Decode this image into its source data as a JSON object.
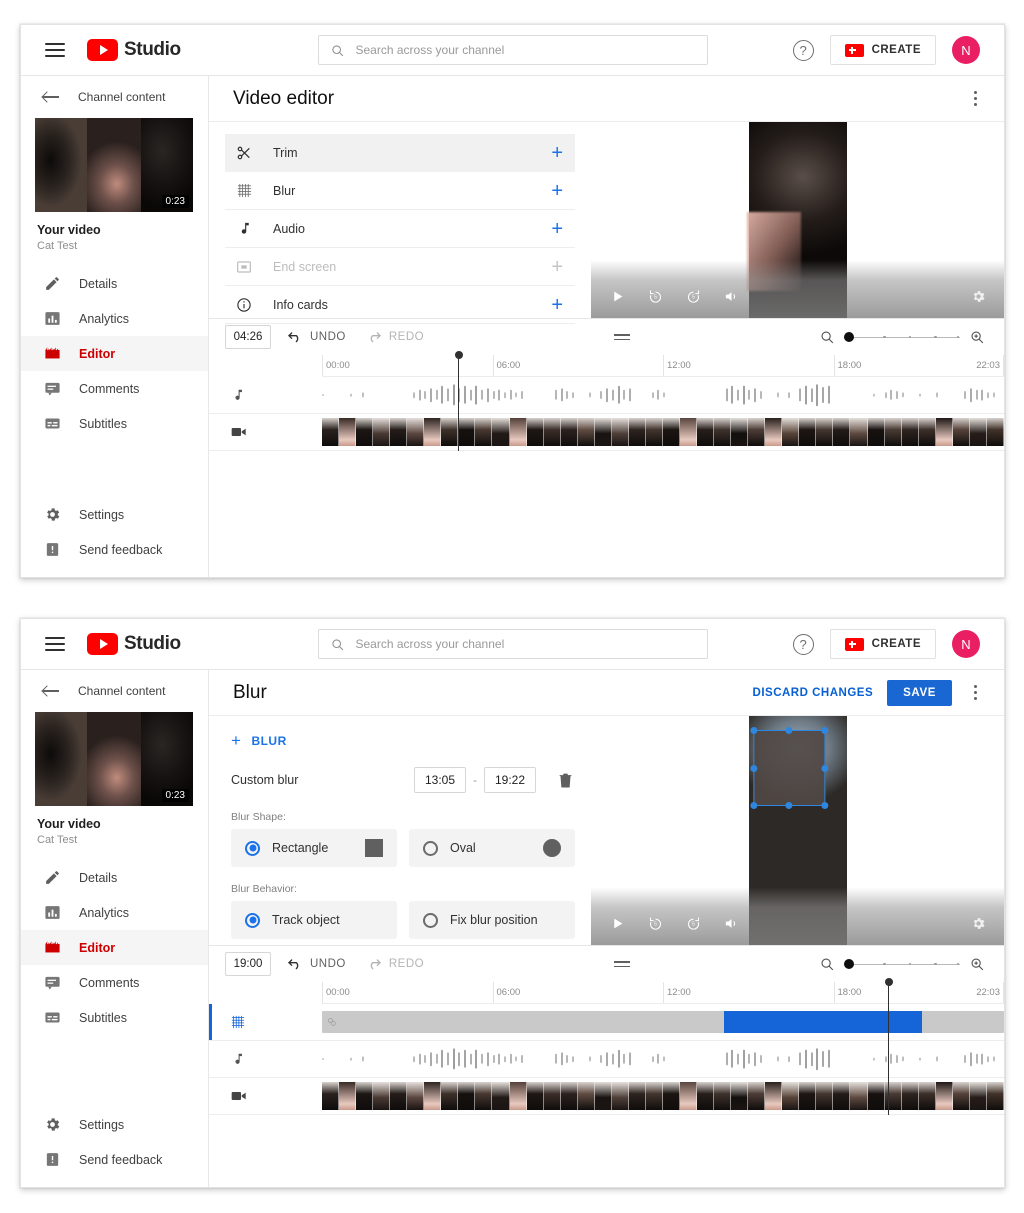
{
  "masthead": {
    "menu_icon": "hamburger-menu-icon",
    "logo_text": "Studio",
    "search_placeholder": "Search across your channel",
    "search_value": "",
    "help_icon": "help-circle-icon",
    "create_label": "CREATE",
    "avatar_initial": "N"
  },
  "sidebar": {
    "back_label": "Channel content",
    "video_duration": "0:23",
    "video_title": "Your video",
    "video_subtitle": "Cat Test",
    "items": [
      {
        "label": "Details",
        "icon": "pencil-icon",
        "active": false
      },
      {
        "label": "Analytics",
        "icon": "bar-chart-icon",
        "active": false
      },
      {
        "label": "Editor",
        "icon": "clapperboard-icon",
        "active": true
      },
      {
        "label": "Comments",
        "icon": "comment-icon",
        "active": false
      },
      {
        "label": "Subtitles",
        "icon": "subtitles-icon",
        "active": false
      }
    ],
    "bottom_items": [
      {
        "label": "Settings",
        "icon": "gear-icon"
      },
      {
        "label": "Send feedback",
        "icon": "feedback-icon"
      }
    ]
  },
  "panel_top": {
    "page_title": "Video editor",
    "tools": [
      {
        "label": "Trim",
        "icon": "scissors-icon",
        "selected": true,
        "disabled": false
      },
      {
        "label": "Blur",
        "icon": "blur-grid-icon",
        "selected": false,
        "disabled": false
      },
      {
        "label": "Audio",
        "icon": "music-note-icon",
        "selected": false,
        "disabled": false
      },
      {
        "label": "End screen",
        "icon": "end-screen-icon",
        "selected": false,
        "disabled": true
      },
      {
        "label": "Info cards",
        "icon": "info-circle-icon",
        "selected": false,
        "disabled": false
      }
    ],
    "timeline": {
      "current_time": "04:26",
      "undo_label": "UNDO",
      "redo_label": "REDO",
      "undo_enabled": true,
      "redo_enabled": false,
      "playhead_percent": 20,
      "ruler_ticks": [
        "00:00",
        "06:00",
        "12:00",
        "18:00",
        "22:03"
      ],
      "zoom_level_percent": 0,
      "tracks": [
        {
          "name": "audio",
          "icon": "music-note-icon"
        },
        {
          "name": "video",
          "icon": "video-camera-icon"
        }
      ]
    },
    "player": {
      "play_icon": "play-icon",
      "rewind_label": "5",
      "forward_label": "5",
      "volume_icon": "volume-icon",
      "settings_icon": "gear-icon"
    }
  },
  "panel_bottom": {
    "page_title": "Blur",
    "discard_label": "DISCARD CHANGES",
    "save_label": "SAVE",
    "blur": {
      "add_blur_label": "BLUR",
      "custom_blur_label": "Custom blur",
      "start_time": "13:05",
      "end_time": "19:22",
      "separator": "-",
      "delete_icon": "trash-icon",
      "shape_group_label": "Blur Shape:",
      "shape_options": [
        {
          "label": "Rectangle",
          "selected": true,
          "swatch": "square"
        },
        {
          "label": "Oval",
          "selected": false,
          "swatch": "circle"
        }
      ],
      "behavior_group_label": "Blur Behavior:",
      "behavior_options": [
        {
          "label": "Track object",
          "selected": true
        },
        {
          "label": "Fix blur position",
          "selected": false
        }
      ]
    },
    "timeline": {
      "current_time": "19:00",
      "undo_label": "UNDO",
      "redo_label": "REDO",
      "undo_enabled": true,
      "redo_enabled": false,
      "playhead_percent": 83,
      "ruler_ticks": [
        "00:00",
        "06:00",
        "12:00",
        "18:00",
        "22:03"
      ],
      "zoom_level_percent": 0,
      "clip": {
        "selection_start_percent": 59,
        "selection_end_percent": 88
      },
      "tracks": [
        {
          "name": "blur",
          "icon": "blur-grid-icon"
        },
        {
          "name": "audio",
          "icon": "music-note-icon"
        },
        {
          "name": "video",
          "icon": "video-camera-icon"
        }
      ]
    },
    "player": {
      "play_icon": "play-icon",
      "rewind_label": "5",
      "forward_label": "5",
      "volume_icon": "volume-icon",
      "settings_icon": "gear-icon"
    }
  },
  "colors": {
    "brand_red": "#ff0000",
    "accent_blue": "#1a73e8",
    "save_blue": "#1967d2",
    "clip_blue": "#1565d8",
    "avatar_pink": "#e91e63",
    "active_red": "#cc0000"
  }
}
